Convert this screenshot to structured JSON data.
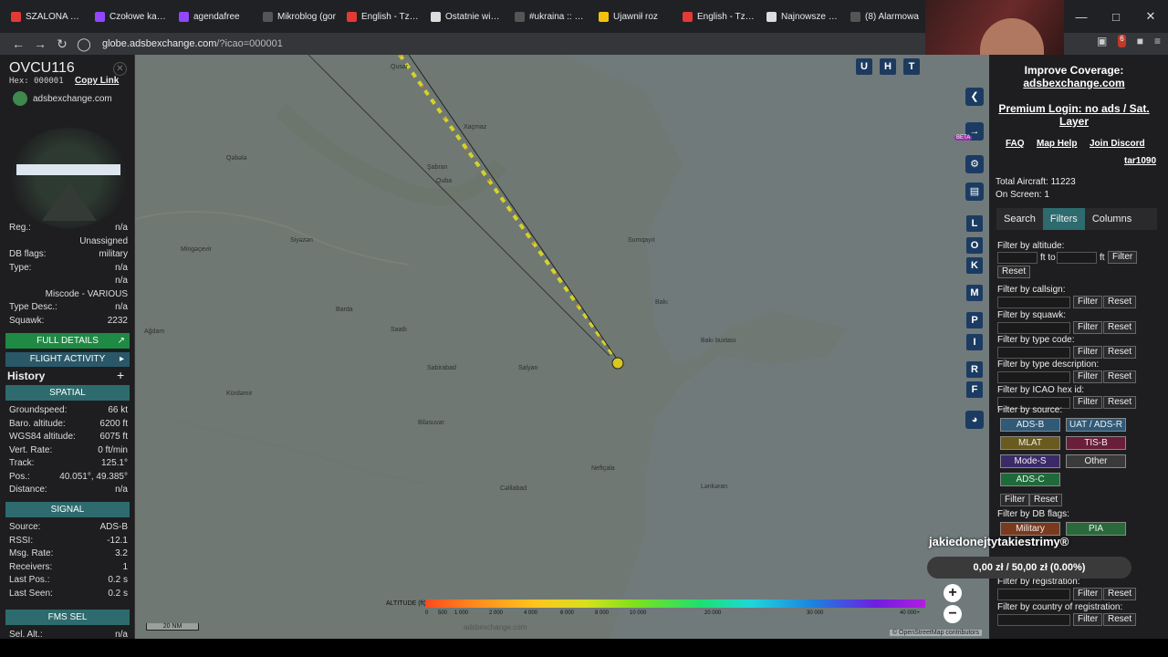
{
  "browser": {
    "tabs": [
      {
        "label": "SZALONA WTO",
        "color": "#e53935"
      },
      {
        "label": "Czołowe kanały",
        "color": "#9147ff"
      },
      {
        "label": "agendafree",
        "color": "#9147ff"
      },
      {
        "label": "Mikroblog (gor",
        "color": "#555555"
      },
      {
        "label": "English - Tzofar",
        "color": "#e53935"
      },
      {
        "label": "Ostatnie wiado",
        "color": "#dddddd"
      },
      {
        "label": "#ukraina :: Wyk",
        "color": "#555555"
      },
      {
        "label": "Ujawnił roz",
        "color": "#f4c20d"
      },
      {
        "label": "English - Tzofar",
        "color": "#e53935"
      },
      {
        "label": "Najnowsze Iran",
        "color": "#dddddd"
      },
      {
        "label": "(8) Alarmowa",
        "color": "#555555"
      }
    ],
    "url_host": "globe.adsbexchange.com",
    "url_path": "/?icao=000001",
    "ext_badge": "6"
  },
  "aircraft": {
    "callsign": "OVCU116",
    "hex_label": "Hex:",
    "hex": "000001",
    "copy_link": "Copy Link",
    "brand": "adsbexchange.com",
    "info": [
      {
        "k": "Reg.:",
        "v": "n/a"
      },
      {
        "k": "",
        "v": "Unassigned"
      },
      {
        "k": "DB flags:",
        "v": "military"
      },
      {
        "k": "Type:",
        "v": "n/a"
      },
      {
        "k": "",
        "v": "n/a"
      },
      {
        "k": "",
        "v": "Miscode - VARIOUS"
      },
      {
        "k": "Type Desc.:",
        "v": "n/a"
      },
      {
        "k": "Squawk:",
        "v": "2232"
      }
    ],
    "full_details": "FULL DETAILS",
    "flight_activity": "FLIGHT ACTIVITY",
    "history": "History",
    "spatial_title": "SPATIAL",
    "spatial": [
      {
        "k": "Groundspeed:",
        "v": "66 kt"
      },
      {
        "k": "Baro. altitude:",
        "v": "6200 ft"
      },
      {
        "k": "WGS84 altitude:",
        "v": "6075 ft"
      },
      {
        "k": "Vert. Rate:",
        "v": "0 ft/min"
      },
      {
        "k": "Track:",
        "v": "125.1°"
      },
      {
        "k": "Pos.:",
        "v": "40.051°, 49.385°"
      },
      {
        "k": "Distance:",
        "v": "n/a"
      }
    ],
    "signal_title": "SIGNAL",
    "signal": [
      {
        "k": "Source:",
        "v": "ADS-B"
      },
      {
        "k": "RSSI:",
        "v": "-12.1"
      },
      {
        "k": "Msg. Rate:",
        "v": "3.2"
      },
      {
        "k": "Receivers:",
        "v": "1"
      },
      {
        "k": "Last Pos.:",
        "v": "0.2 s"
      },
      {
        "k": "Last Seen:",
        "v": "0.2 s"
      }
    ],
    "fms_title": "FMS SEL",
    "sel_alt": {
      "k": "Sel. Alt.:",
      "v": "n/a"
    }
  },
  "map": {
    "places": [
      "Qusar",
      "Xaçmaz",
      "Şabran",
      "Quba",
      "Qəbələ",
      "Mingəçevir",
      "Siyəzən",
      "Sumqayıt",
      "Bakı",
      "Bakı buxtası",
      "Barda",
      "Saatlı",
      "Sabirabad",
      "Salyan",
      "Kürdəmir",
      "Lənkəran",
      "Neftçala",
      "Biləsuvar",
      "Cəlilabad",
      "Ağdam"
    ],
    "toggle_buttons": [
      "U",
      "H",
      "T"
    ],
    "side_letters": [
      "L",
      "O",
      "K",
      "M",
      "P",
      "I",
      "R",
      "F"
    ],
    "beta": "BETA",
    "altitude_label": "ALTITUDE (ft)",
    "altitude_ticks": [
      "0",
      "500",
      "1 000",
      "2 000",
      "4 000",
      "6 000",
      "8 000",
      "10 000",
      "20 000",
      "30 000",
      "40 000+"
    ],
    "scale": "20 NM",
    "attribution": "© OpenStreetMap contributors",
    "watermark": "adsbexchange.com"
  },
  "overlay": {
    "stream_title": "jakiedonejtytakiestrimy®",
    "donate": "0,00 zł / 50,00 zł (0.00%)"
  },
  "right": {
    "improve": "Improve Coverage:",
    "improve_link": "adsbexchange.com",
    "premium": "Premium Login: no ads / Sat. Layer",
    "faq": "FAQ",
    "map_help": "Map Help",
    "discord": "Join Discord",
    "tar": "tar1090",
    "total": "Total Aircraft: 11223",
    "onscreen": "On Screen: 1",
    "tabs": [
      "Search",
      "Filters",
      "Columns"
    ],
    "f_alt": "Filter by altitude:",
    "ft_to": "ft to",
    "ft": "ft",
    "filter": "Filter",
    "reset": "Reset",
    "f_callsign": "Filter by callsign:",
    "f_squawk": "Filter by squawk:",
    "f_type": "Filter by type code:",
    "f_desc": "Filter by type description:",
    "f_icao": "Filter by ICAO hex id:",
    "f_source": "Filter by source:",
    "sources": [
      {
        "label": "ADS-B",
        "color": "#2f5a78"
      },
      {
        "label": "UAT / ADS-R",
        "color": "#2f5a78"
      },
      {
        "label": "MLAT",
        "color": "#6a5a1e"
      },
      {
        "label": "TIS-B",
        "color": "#6a1e3a"
      },
      {
        "label": "Mode-S",
        "color": "#3a2a6a"
      },
      {
        "label": "Other",
        "color": "#3a3a3a"
      },
      {
        "label": "ADS-C",
        "color": "#1e6a3a"
      }
    ],
    "f_db": "Filter by DB flags:",
    "db": [
      {
        "label": "Military",
        "color": "#7a3a1e"
      },
      {
        "label": "PIA",
        "color": "#2a6a3a"
      }
    ],
    "f_reg": "Filter by registration:",
    "f_country": "Filter by country of registration:"
  }
}
